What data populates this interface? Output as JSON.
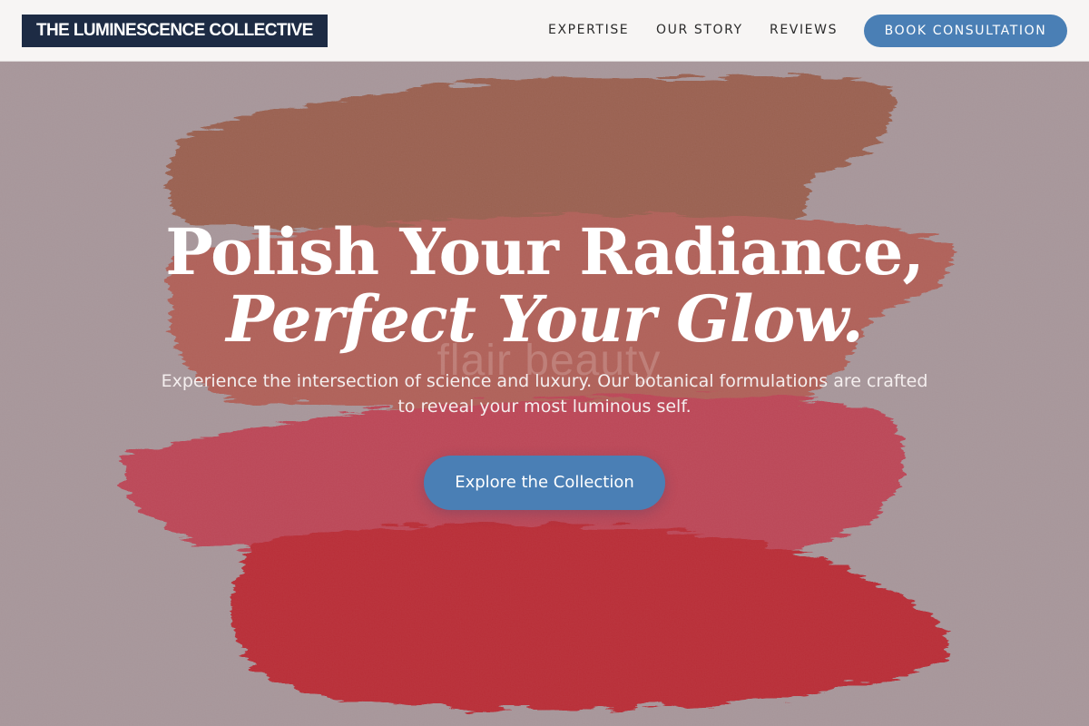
{
  "brand": {
    "logo_text": "THE LUMINESCENCE COLLECTIVE",
    "logo_bg": "#1d2b44"
  },
  "nav": {
    "links": [
      "EXPERTISE",
      "OUR STORY",
      "REVIEWS"
    ],
    "cta_label": "BOOK CONSULTATION"
  },
  "hero": {
    "headline_line1": "Polish Your Radiance,",
    "headline_line2": "Perfect Your Glow.",
    "subtext": "Experience the intersection of science and luxury. Our botanical formulations are crafted to reveal your most luminous self.",
    "cta_label": "Explore the Collection",
    "background_watermark": "flair beauty"
  },
  "colors": {
    "accent": "#4a7fb5",
    "swatch_brown": "#9b5a44",
    "swatch_terracotta": "#b55a50",
    "swatch_pink_red": "#c43a4e",
    "swatch_red": "#c01a26"
  }
}
